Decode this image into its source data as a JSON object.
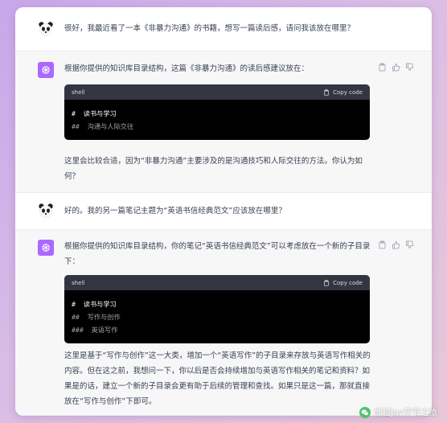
{
  "messages": [
    {
      "role": "user",
      "text": "很好，我最近看了一本《非暴力沟通》的书籍，想写一篇读后感，请问我该放在哪里？"
    },
    {
      "role": "assistant",
      "intro": "根据你提供的知识库目录结构，这篇《非暴力沟通》的读后感建议放在：",
      "code": {
        "lang": "shell",
        "copy_label": "Copy code",
        "lines": [
          "#  读书与学习",
          "##  沟通与人际交往"
        ]
      },
      "outro_lines": [
        "这里会比较合适，因为“非暴力沟通”主要涉及的是沟通技巧和人际交往的方法。你认为如",
        "何？"
      ]
    },
    {
      "role": "user",
      "text": "好的。我的另一篇笔记主题为“英语书信经典范文”应该放在哪里？"
    },
    {
      "role": "assistant",
      "intro_lines": [
        "根据你提供的知识库目录结构，你的笔记“英语书信经典范文”可以考虑放在一个新的子目录",
        "下："
      ],
      "code": {
        "lang": "shell",
        "copy_label": "Copy code",
        "lines": [
          "#  读书与学习",
          "##  写作与创作",
          "###  英语写作"
        ]
      },
      "outro_lines": [
        "这里是基于“写作与创作”这一大类，增加一个“英语写作”的子目录来存放与英语写作相关的",
        "内容。但在这之前，我想问一下，你以后是否会持续增加与英语写作相关的笔记和资料？如",
        "果是的话，建立一个新的子目录会更有助于后续的管理和查找。如果只是这一篇，那就直接",
        "放在“写作与创作”下即可。"
      ]
    }
  ],
  "watermark": "熊猫Jay字节之旅",
  "icons": [
    "panda-avatar-icon",
    "openai-logo-icon",
    "clipboard-icon",
    "thumbs-up-icon",
    "thumbs-down-icon",
    "wechat-icon"
  ],
  "colors": {
    "assistant_avatar": "#ab68ff",
    "code_header": "#343541",
    "code_bg": "#000000"
  }
}
